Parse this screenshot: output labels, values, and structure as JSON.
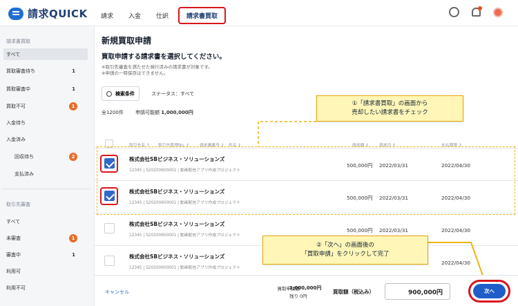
{
  "header": {
    "app_name": "請求QUICK",
    "tabs": [
      "請求",
      "入金",
      "仕訳",
      "請求書買取"
    ]
  },
  "sidebar": {
    "section1": "請求書買取",
    "items": [
      {
        "label": "すべて",
        "count": ""
      },
      {
        "label": "買取審査待ち",
        "count": "1"
      },
      {
        "label": "買取審査中",
        "count": "1"
      },
      {
        "label": "買取不可",
        "count": "1"
      },
      {
        "label": "入金待ち",
        "count": ""
      },
      {
        "label": "入金済み",
        "count": ""
      },
      {
        "label": "回収待ち",
        "count": "2"
      },
      {
        "label": "支払済み",
        "count": ""
      }
    ],
    "section2": "取引先審査",
    "items2": [
      {
        "label": "すべて",
        "count": ""
      },
      {
        "label": "未審査",
        "count": "1"
      },
      {
        "label": "審査中",
        "count": "1"
      },
      {
        "label": "利用可",
        "count": ""
      },
      {
        "label": "利用不可",
        "count": ""
      }
    ]
  },
  "main": {
    "title": "新規買取申請",
    "subtitle": "買取申請する請求書を選択してください。",
    "notes": [
      "※取引先審査を満たせた発行済みの請求書が対象です。",
      "※申請の一時保存はできません。"
    ],
    "filter_label": "検索条件",
    "status_text": "ステータス：すべて",
    "summary_count": "全1200件",
    "summary_label": "申請可能額",
    "summary_amount": "1,000,000円"
  },
  "table": {
    "headers": [
      "取引先名 ↑",
      "取引先管理No. ↕",
      "請求書番号 ↕",
      "件名 ↕",
      "請求額 ↕",
      "請求日 ↕",
      "支払期限 ↕"
    ],
    "rows": [
      {
        "company": "株式会社SBビジネス・ソリューションズ",
        "meta": "12345 | S20200600001 | 動画配信アプリ作成プロジェクト",
        "amount": "500,000円",
        "invoice_date": "2022/03/31",
        "due_date": "2022/04/30",
        "checked": true
      },
      {
        "company": "株式会社SBビジネス・ソリューションズ",
        "meta": "12345 | S20200600001 | 動画配信アプリ作成プロジェクト",
        "amount": "500,000円",
        "invoice_date": "2022/03/31",
        "due_date": "2022/04/30",
        "checked": true
      },
      {
        "company": "株式会社SBビジネス・ソリューションズ",
        "meta": "12345 | S20200600001 | 動画配信アプリ作成プロジェクト",
        "amount": "500,000円",
        "invoice_date": "2022/03/31",
        "due_date": "2022/04/30",
        "checked": false
      },
      {
        "company": "株式会社SBビジネス・ソリューションズ",
        "meta": "12345 | S20200600001 | 動画配信アプリ作成プロジェクト",
        "amount": "",
        "invoice_date": "",
        "due_date": "2022/04/30",
        "checked": false
      }
    ]
  },
  "callouts": {
    "callout1_line1": "①「請求書買取」の画面から",
    "callout1_line2": "売却したい請求書をチェック",
    "callout2_line1": "②「次へ」の画面後の",
    "callout2_line2": "「買取申請」をクリックして完了"
  },
  "footer": {
    "cancel": "キャンセル",
    "requested_label": "買取申請額",
    "requested_amount": "1,000,000円",
    "remaining_label": "残り",
    "remaining_amount": "0円",
    "purchase_label": "買取額（税込み）",
    "purchase_amount": "900,000円",
    "next_label": "次へ"
  },
  "colors": {
    "accent": "#1f5ec8",
    "highlight_red": "#d9141d",
    "callout_yellow": "#fff6b8",
    "badge_orange": "#e86d2b"
  }
}
